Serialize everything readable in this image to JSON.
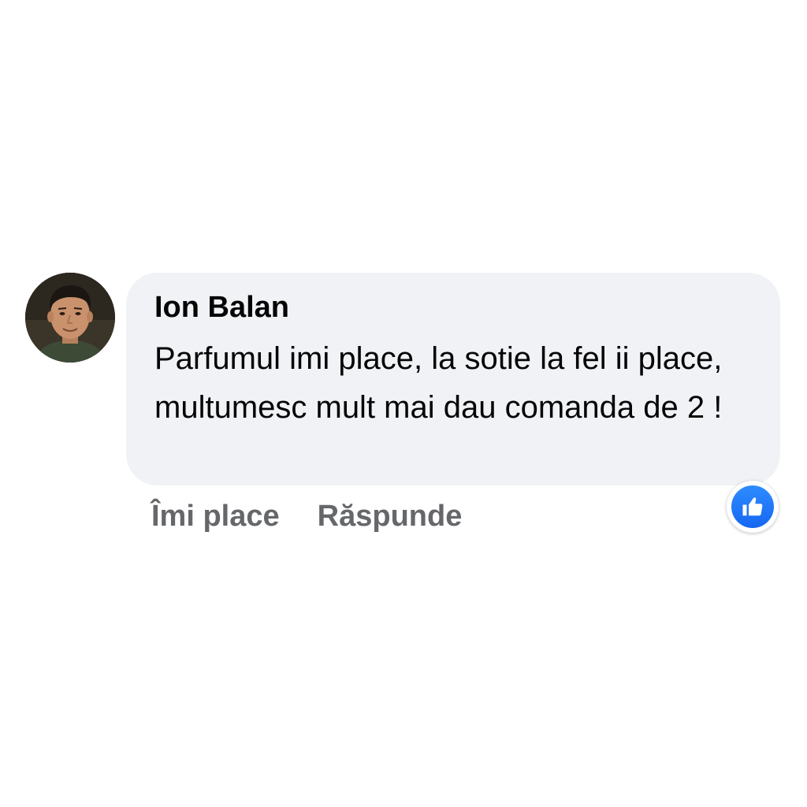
{
  "comment": {
    "author": "Ion Balan",
    "text": "Parfumul imi place, la sotie la fel ii place, multumesc mult mai dau comanda de 2 !",
    "avatar": {
      "icon": "profile-photo",
      "description_colors": {
        "background": "#3a3326",
        "skin": "#c9916c",
        "hair": "#1c1612",
        "shirt": "#3c4a36"
      }
    }
  },
  "actions": {
    "like_label": "Îmi place",
    "reply_label": "Răspunde"
  },
  "reaction": {
    "icon": "thumbs-up-icon",
    "color": "#1877f2"
  },
  "colors": {
    "bubble": "#f1f2f6",
    "text": "#050505",
    "secondary_text": "#65676b",
    "background": "#ffffff"
  }
}
